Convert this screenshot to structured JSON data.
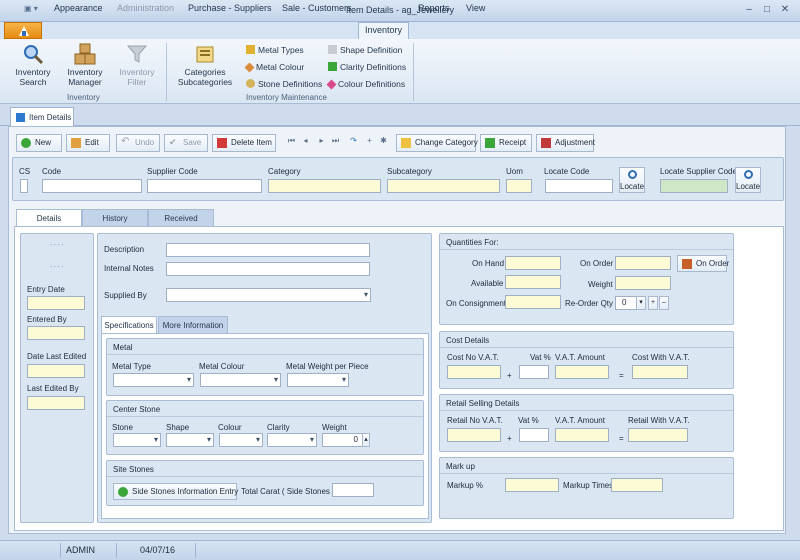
{
  "window": {
    "title": "Item Details - ag_Jewellery"
  },
  "menu": {
    "items": [
      "Appearance",
      "Administration",
      "Purchase - Suppliers",
      "Sale - Customers",
      "Inventory",
      "Reports",
      "View"
    ],
    "active": "Inventory"
  },
  "ribbon": {
    "inventory_search": "Inventory\nSearch",
    "inventory_manager": "Inventory\nManager",
    "inventory_filter": "Inventory\nFilter",
    "categories_subcategories": "Categories\nSubcategories",
    "metal_types": "Metal Types",
    "metal_colour": "Metal Colour",
    "stone_definitions": "Stone Definitions",
    "shape_definition": "Shape Definition",
    "clarity_definitions": "Clarity Definitions",
    "colour_definitions": "Colour Definitions",
    "group_inventory": "Inventory",
    "group_maintenance": "Inventory Maintenance"
  },
  "doc_tab": "Item Details",
  "toolbar": {
    "new": "New",
    "edit": "Edit",
    "undo": "Undo",
    "save": "Save",
    "delete_item": "Delete Item",
    "change_category": "Change Category",
    "receipt": "Receipt",
    "adjustment": "Adjustment"
  },
  "header_fields": {
    "cs": "CS",
    "code": "Code",
    "supplier_code": "Supplier Code",
    "category": "Category",
    "subcategory": "Subcategory",
    "uom": "Uom",
    "locate_code": "Locate Code",
    "locate": "Locate",
    "locate_supplier_code": "Locate Supplier Code"
  },
  "tabs": {
    "details": "Details",
    "history": "History",
    "received": "Received"
  },
  "left_panel": {
    "dots1": "····",
    "dots2": "····",
    "entry_date": "Entry Date",
    "entered_by": "Entered By",
    "date_last_edited": "Date Last Edited",
    "last_edited_by": "Last Edited By"
  },
  "desc": {
    "description": "Description",
    "internal_notes": "Internal Notes",
    "supplied_by": "Supplied By"
  },
  "spec_tabs": {
    "specifications": "Specifications",
    "more_information": "More Information"
  },
  "metal": {
    "title": "Metal",
    "metal_type": "Metal Type",
    "metal_colour": "Metal Colour",
    "metal_weight": "Metal Weight per Piece"
  },
  "center_stone": {
    "title": "Center Stone",
    "stone": "Stone",
    "shape": "Shape",
    "colour": "Colour",
    "clarity": "Clarity",
    "weight": "Weight",
    "weight_value": "0"
  },
  "side_stones": {
    "title": "Site Stones",
    "button": "Side Stones Information Entry",
    "total_carat": "Total Carat ( Side Stones )"
  },
  "quantities": {
    "title": "Quantities For:",
    "on_hand": "On Hand",
    "available": "Available",
    "on_consignment": "On Consignment",
    "on_order": "On Order",
    "weight": "Weight",
    "reorder_qty": "Re-Order Qty",
    "reorder_value": "0",
    "on_order_button": "On Order"
  },
  "cost": {
    "title": "Cost Details",
    "cost_no_vat": "Cost No V.A.T.",
    "vat_pct": "Vat %",
    "vat_amount": "V.A.T. Amount",
    "cost_with_vat": "Cost With V.A.T.",
    "plus": "+",
    "equals": "="
  },
  "retail": {
    "title": "Retail Selling Details",
    "retail_no_vat": "Retail No V.A.T.",
    "vat_pct": "Vat %",
    "vat_amount": "V.A.T. Amount",
    "retail_with_vat": "Retail With V.A.T.",
    "plus": "+",
    "equals": "="
  },
  "markup": {
    "title": "Mark up",
    "markup_pct": "Markup %",
    "markup_times": "Markup Times"
  },
  "status": {
    "user": "ADMIN",
    "date": "04/07/16"
  },
  "colors": {
    "accent": "#2f6db4",
    "input_yellow": "#fdfbd6",
    "panel": "#dbe6f3",
    "file_orange": "#f0a030"
  }
}
